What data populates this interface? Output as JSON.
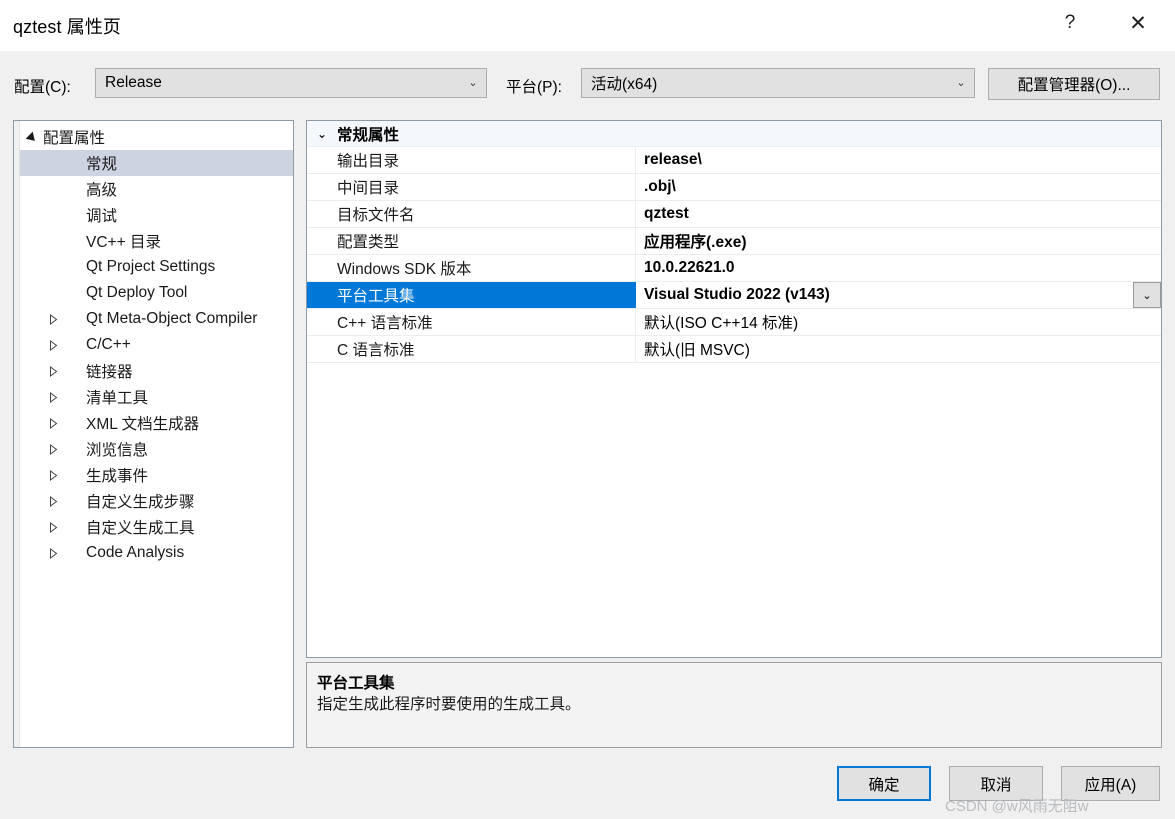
{
  "window": {
    "title": "qztest 属性页",
    "help_icon": "?",
    "close_icon": "✕"
  },
  "toolbar": {
    "config_label": "配置(C):",
    "config_value": "Release",
    "platform_label": "平台(P):",
    "platform_value": "活动(x64)",
    "config_manager_label": "配置管理器(O)...",
    "dropdown_icon": "⌄"
  },
  "tree": {
    "items": [
      {
        "label": "配置属性",
        "level": 0,
        "state": "expanded",
        "selected": false
      },
      {
        "label": "常规",
        "level": 1,
        "state": "leaf",
        "selected": true
      },
      {
        "label": "高级",
        "level": 1,
        "state": "leaf",
        "selected": false
      },
      {
        "label": "调试",
        "level": 1,
        "state": "leaf",
        "selected": false
      },
      {
        "label": "VC++ 目录",
        "level": 1,
        "state": "leaf",
        "selected": false
      },
      {
        "label": "Qt Project Settings",
        "level": 1,
        "state": "leaf",
        "selected": false
      },
      {
        "label": "Qt Deploy Tool",
        "level": 1,
        "state": "leaf",
        "selected": false
      },
      {
        "label": "Qt Meta-Object Compiler",
        "level": 1,
        "state": "collapsed",
        "selected": false
      },
      {
        "label": "C/C++",
        "level": 1,
        "state": "collapsed",
        "selected": false
      },
      {
        "label": "链接器",
        "level": 1,
        "state": "collapsed",
        "selected": false
      },
      {
        "label": "清单工具",
        "level": 1,
        "state": "collapsed",
        "selected": false
      },
      {
        "label": "XML 文档生成器",
        "level": 1,
        "state": "collapsed",
        "selected": false
      },
      {
        "label": "浏览信息",
        "level": 1,
        "state": "collapsed",
        "selected": false
      },
      {
        "label": "生成事件",
        "level": 1,
        "state": "collapsed",
        "selected": false
      },
      {
        "label": "自定义生成步骤",
        "level": 1,
        "state": "collapsed",
        "selected": false
      },
      {
        "label": "自定义生成工具",
        "level": 1,
        "state": "collapsed",
        "selected": false
      },
      {
        "label": "Code Analysis",
        "level": 1,
        "state": "collapsed",
        "selected": false
      }
    ]
  },
  "grid": {
    "group_header": "常规属性",
    "group_expander_icon": "⌄",
    "rows": [
      {
        "name": "输出目录",
        "value": "release\\",
        "bold": true,
        "selected": false,
        "has_dropdown": false
      },
      {
        "name": "中间目录",
        "value": ".obj\\",
        "bold": true,
        "selected": false,
        "has_dropdown": false
      },
      {
        "name": "目标文件名",
        "value": "qztest",
        "bold": true,
        "selected": false,
        "has_dropdown": false
      },
      {
        "name": "配置类型",
        "value": "应用程序(.exe)",
        "bold": true,
        "selected": false,
        "has_dropdown": false
      },
      {
        "name": "Windows SDK 版本",
        "value": "10.0.22621.0",
        "bold": true,
        "selected": false,
        "has_dropdown": false
      },
      {
        "name": "平台工具集",
        "value": "Visual Studio 2022 (v143)",
        "bold": true,
        "selected": true,
        "has_dropdown": true
      },
      {
        "name": "C++ 语言标准",
        "value": "默认(ISO C++14 标准)",
        "bold": false,
        "selected": false,
        "has_dropdown": false
      },
      {
        "name": "C 语言标准",
        "value": "默认(旧 MSVC)",
        "bold": false,
        "selected": false,
        "has_dropdown": false
      }
    ],
    "cell_dropdown_icon": "⌄"
  },
  "description": {
    "title": "平台工具集",
    "body": "指定生成此程序时要使用的生成工具。"
  },
  "footer": {
    "ok_label": "确定",
    "cancel_label": "取消",
    "apply_label": "应用(A)"
  },
  "watermark": {
    "text": "CSDN @w风雨无阻w"
  },
  "colors": {
    "selection_blue": "#0078d7",
    "tree_selection": "#cdd3e0",
    "dialog_bg": "#f0f0f0",
    "panel_border": "#8e9aa6"
  }
}
